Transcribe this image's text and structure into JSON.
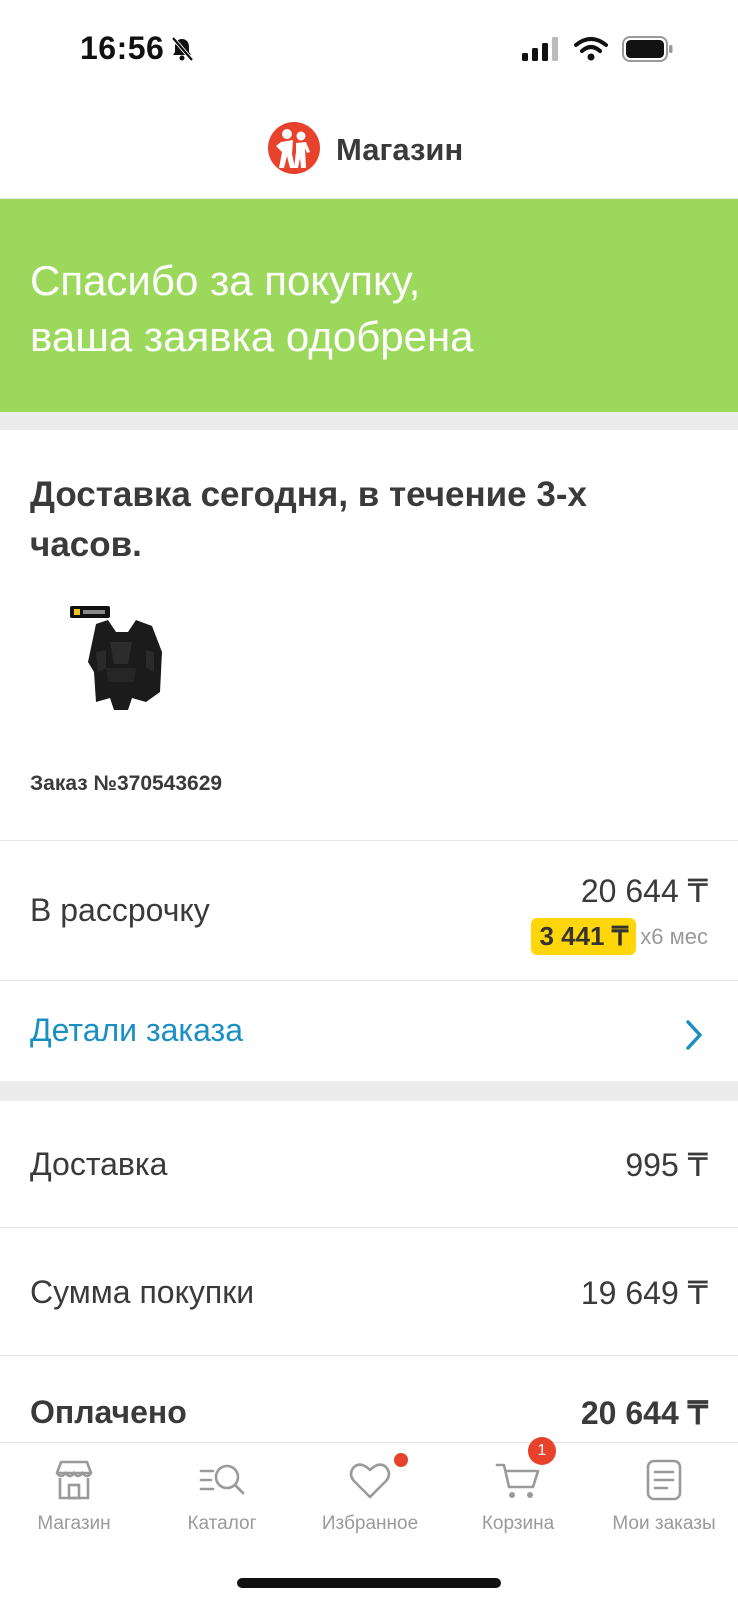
{
  "status_bar": {
    "time": "16:56"
  },
  "header": {
    "store_name": "Магазин"
  },
  "banner": {
    "text": "Спасибо за покупку,\nваша заявка одобрена",
    "color": "#9bd85c"
  },
  "order": {
    "delivery_title": "Доставка сегодня, в течение 3-х часов.",
    "number_label": "Заказ №370543629"
  },
  "installment": {
    "label": "В рассрочку",
    "total": "20 644 ₸",
    "monthly_amount": "3 441 ₸",
    "term": "x6 мес"
  },
  "details_link": {
    "label": "Детали заказа"
  },
  "summary": {
    "rows": [
      {
        "label": "Доставка",
        "value": "995 ₸"
      },
      {
        "label": "Сумма покупки",
        "value": "19 649 ₸"
      },
      {
        "label": "Оплачено",
        "value": "20 644 ₸"
      }
    ]
  },
  "tabbar": {
    "tabs": [
      {
        "label": "Магазин",
        "icon": "store-icon"
      },
      {
        "label": "Каталог",
        "icon": "catalog-search-icon"
      },
      {
        "label": "Избранное",
        "icon": "heart-icon"
      },
      {
        "label": "Корзина",
        "icon": "cart-icon"
      },
      {
        "label": "Мои заказы",
        "icon": "orders-icon"
      }
    ],
    "cart_count": "1"
  },
  "colors": {
    "accent_link": "#1a8fc4",
    "badge_red": "#e8412c",
    "installment_yellow": "#ffd60a"
  }
}
